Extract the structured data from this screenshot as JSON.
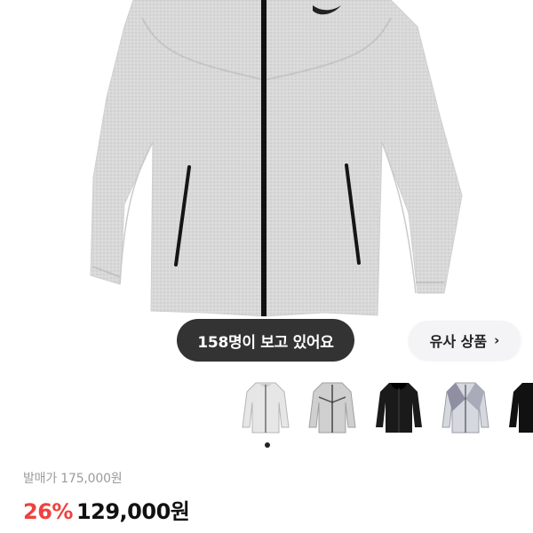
{
  "product_image": {
    "description_icon": "zip-hoodie-image",
    "brand_icon": "swoosh-logo-icon"
  },
  "viewer_badge": {
    "label": "158명이 보고 있어요"
  },
  "similar_products": {
    "label": "유사 상품",
    "chevron": "›",
    "thumbnails": [
      {
        "color": "#e6e6e6",
        "icon": "white-hoodie-thumb"
      },
      {
        "color": "#cfcfcf",
        "icon": "grey-hoodie-thumb"
      },
      {
        "color": "#1a1a1a",
        "icon": "black-hoodie-thumb"
      },
      {
        "color": "#d6d8e0",
        "icon": "grey-purple-hoodie-thumb"
      },
      {
        "color": "#111111",
        "icon": "black-hoodie-thumb-2"
      }
    ],
    "carousel_page": 1
  },
  "pricing": {
    "original_label": "발매가 175,000원",
    "discount": "26%",
    "price": "129,000원",
    "colors": {
      "discount": "#f0413e",
      "price": "#111111"
    }
  }
}
